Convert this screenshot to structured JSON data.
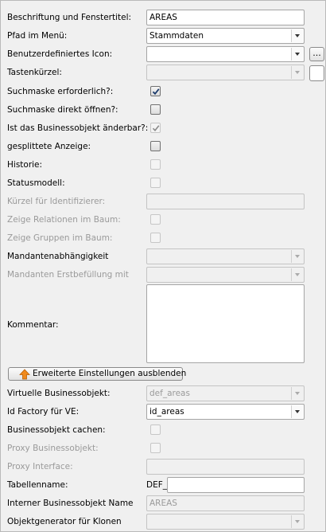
{
  "rows": {
    "title": {
      "label": "Beschriftung und Fenstertitel:",
      "value": "AREAS"
    },
    "menu_path": {
      "label": "Pfad im Menü:",
      "value": "Stammdaten"
    },
    "icon": {
      "label": "Benutzerdefiniertes Icon:",
      "value": "",
      "browse": "..."
    },
    "shortcut": {
      "label": "Tastenkürzel:",
      "value": ""
    },
    "search_required": {
      "label": "Suchmaske erforderlich?:",
      "checked": true
    },
    "search_direct": {
      "label": "Suchmaske direkt öffnen?:",
      "checked": false
    },
    "editable": {
      "label": "Ist das Businessobjekt änderbar?:",
      "checked": true
    },
    "split_view": {
      "label": "gesplittete Anzeige:",
      "checked": false
    },
    "history": {
      "label": "Historie:",
      "checked": false
    },
    "status_model": {
      "label": "Statusmodell:",
      "checked": false
    },
    "identifier_shortcut": {
      "label": "Kürzel für Identifizierer:",
      "value": ""
    },
    "relations_tree": {
      "label": "Zeige Relationen im Baum:",
      "checked": false
    },
    "groups_tree": {
      "label": "Zeige Gruppen im Baum:",
      "checked": false
    },
    "client_dependency": {
      "label": "Mandantenabhängigkeit",
      "value": ""
    },
    "client_initial_fill": {
      "label": "Mandanten Erstbefüllung mit",
      "value": ""
    },
    "comment": {
      "label": "Kommentar:",
      "value": ""
    }
  },
  "toggle_button": {
    "label": "Erweiterte Einstellungen ausblenden",
    "icon": "arrow-up-icon"
  },
  "advanced": {
    "virtual_bo": {
      "label": "Virtuelle Businessobjekt:",
      "value": "def_areas"
    },
    "id_factory": {
      "label": "Id Factory für VE:",
      "value": "id_areas"
    },
    "cache_bo": {
      "label": "Businessobjekt cachen:",
      "checked": false
    },
    "proxy_bo": {
      "label": "Proxy Businessobjekt:",
      "checked": false
    },
    "proxy_interface": {
      "label": "Proxy Interface:",
      "value": ""
    },
    "table_name": {
      "label": "Tabellenname:",
      "prefix": "DEF_",
      "value": ""
    },
    "internal_name": {
      "label": "Interner Businessobjekt Name",
      "value": "AREAS"
    },
    "object_generator": {
      "label": "Objektgenerator für Klonen",
      "value": ""
    }
  },
  "colors": {
    "accent_arrow": "#f08a1c",
    "check": "#1b3a6b"
  }
}
